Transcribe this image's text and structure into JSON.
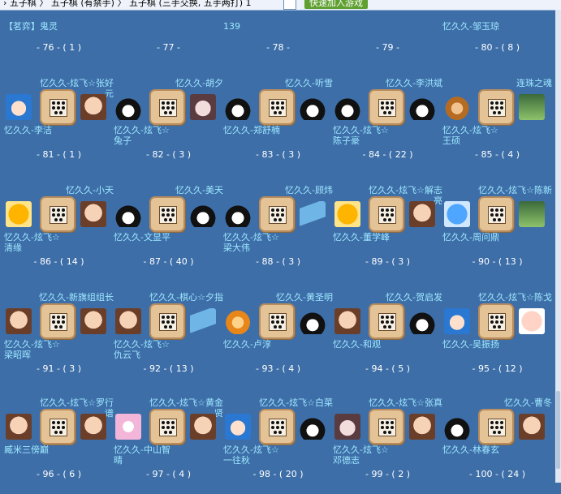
{
  "toolbar": {
    "breadcrumb": "› 五子棋  〉 五子棋 (有禁手)  〉 五子棋 (三手交换, 五手两打) 1",
    "join_button": "快速加入游戏"
  },
  "rows": [
    {
      "cells": [
        {
          "number": "- 76 - ( 1 )",
          "top_left": "【茗弈】鬼灵",
          "top_right": ""
        },
        {
          "number": "- 77 -",
          "top_left": "",
          "top_right": ""
        },
        {
          "number": "- 78 -",
          "top_left": "139",
          "top_right": ""
        },
        {
          "number": "- 79 -",
          "top_left": "",
          "top_right": ""
        },
        {
          "number": "- 80 - ( 8 )",
          "top_left": "忆久久-邹玉琼",
          "top_right": ""
        }
      ]
    },
    {
      "cells": [
        {
          "number": "- 81 - ( 1 )",
          "upper": "忆久久-炫飞☆张好元",
          "lower": "忆久久-李洁",
          "left_avatar": "av-anime",
          "right_avatar": "av-face"
        },
        {
          "number": "- 82 - ( 3 )",
          "upper": "忆久久-胡夕",
          "lower": "忆久久-炫飞☆兔子",
          "left_avatar": "av-penguin",
          "right_avatar": "av-girl"
        },
        {
          "number": "- 83 - ( 3 )",
          "upper": "忆久久-听雪",
          "lower": "忆久久-郑舒楠",
          "left_avatar": "av-penguin",
          "right_avatar": "av-penguin"
        },
        {
          "number": "- 84 - ( 22 )",
          "upper": "忆久久-李洪斌",
          "lower": "忆久久-炫飞☆陈子豪",
          "left_avatar": "av-penguin",
          "right_avatar": "av-penguin"
        },
        {
          "number": "- 85 - ( 4 )",
          "upper": "连珠之魂",
          "lower": "忆久久-炫飞☆王硕",
          "left_avatar": "av-monkey",
          "right_avatar": "av-photo"
        }
      ]
    },
    {
      "cells": [
        {
          "number": "- 86 - ( 14 )",
          "upper": "忆久久-小天",
          "lower": "忆久久-炫飞☆清缘",
          "left_avatar": "av-orange",
          "right_avatar": "av-face"
        },
        {
          "number": "- 87 - ( 40 )",
          "upper": "忆久久-美天",
          "lower": "忆久久-文显平",
          "left_avatar": "av-penguin",
          "right_avatar": "av-penguin"
        },
        {
          "number": "- 88 - ( 3 )",
          "upper": "忆久久-顾炜",
          "lower": "忆久久-炫飞☆梁大伟",
          "left_avatar": "av-penguin",
          "right_avatar": "av-dolphin"
        },
        {
          "number": "- 89 - ( 3 )",
          "upper": "忆久久-炫飞☆解志亮",
          "lower": "忆久久-董学峰",
          "left_avatar": "av-orange",
          "right_avatar": "av-face"
        },
        {
          "number": "- 90 - ( 13 )",
          "upper": "忆久久-炫飞☆陈新",
          "lower": "忆久久-周问鼎",
          "left_avatar": "av-blue",
          "right_avatar": "av-photo"
        }
      ]
    },
    {
      "cells": [
        {
          "number": "- 91 - ( 3 )",
          "upper": "忆久久-新旗组组长",
          "lower": "忆久久-炫飞☆梁昭晖",
          "left_avatar": "av-face",
          "right_avatar": "av-face"
        },
        {
          "number": "- 92 - ( 13 )",
          "upper": "忆久久-棋心☆夕指",
          "lower": "忆久久-炫飞☆仇云飞",
          "left_avatar": "av-face",
          "right_avatar": "av-dolphin"
        },
        {
          "number": "- 93 - ( 4 )",
          "upper": "忆久久-黄圣明",
          "lower": "忆久久-卢淳",
          "left_avatar": "av-tiger",
          "right_avatar": "av-penguin"
        },
        {
          "number": "- 94 - ( 5 )",
          "upper": "忆久久-贺启发",
          "lower": "忆久久-和观",
          "left_avatar": "av-face",
          "right_avatar": "av-penguin"
        },
        {
          "number": "- 95 - ( 12 )",
          "upper": "忆久久-炫飞☆陈戈",
          "lower": "忆久久-吴振扬",
          "left_avatar": "av-anime",
          "right_avatar": "av-baby"
        }
      ]
    },
    {
      "cells": [
        {
          "number": "- 96 - ( 6 )",
          "upper": "忆久久-炫飞☆罗行谱",
          "lower": "臧米三傍巅",
          "left_avatar": "av-face",
          "right_avatar": "av-face"
        },
        {
          "number": "- 97 - ( 4 )",
          "upper": "忆久久-炫飞☆黄金贤",
          "lower": "忆久久-中山智晴",
          "left_avatar": "av-pinkframe",
          "right_avatar": "av-face"
        },
        {
          "number": "- 98 - ( 20 )",
          "upper": "忆久久-炫飞☆白菜",
          "lower": "忆久久-炫飞☆一往秋",
          "left_avatar": "av-anime",
          "right_avatar": "av-penguin"
        },
        {
          "number": "- 99 - ( 2 )",
          "upper": "忆久久-炫飞☆张真",
          "lower": "忆久久-炫飞☆邓德志",
          "left_avatar": "av-girl",
          "right_avatar": "av-face"
        },
        {
          "number": "- 100 - ( 24 )",
          "upper": "忆久久-曹冬",
          "lower": "忆久久-林春玄",
          "left_avatar": "av-penguin",
          "right_avatar": "av-face"
        }
      ]
    }
  ]
}
